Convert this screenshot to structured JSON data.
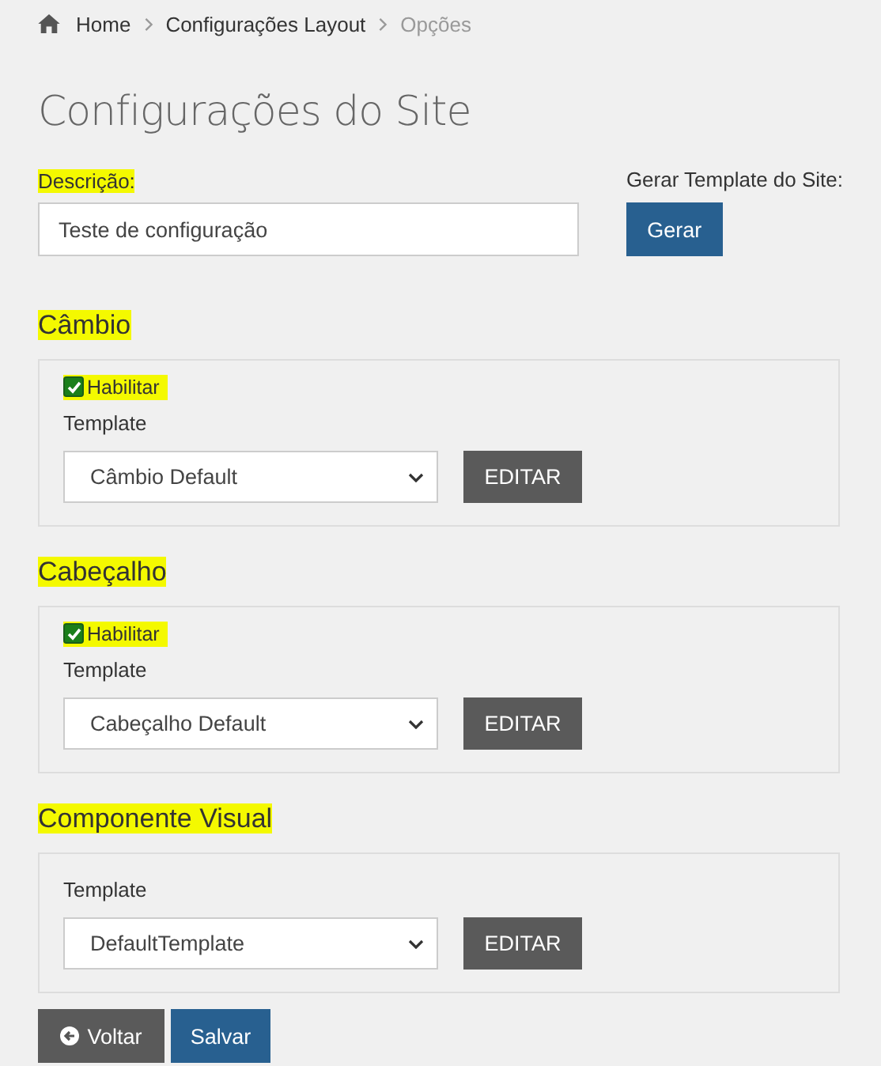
{
  "breadcrumb": [
    {
      "label": "Home",
      "current": false
    },
    {
      "label": "Configurações Layout",
      "current": false
    },
    {
      "label": "Opções",
      "current": true
    }
  ],
  "page_title": "Configurações do Site",
  "description": {
    "label": "Descrição:",
    "highlighted": true,
    "value": "Teste de configuração"
  },
  "generate": {
    "label": "Gerar Template do Site:",
    "button": "Gerar"
  },
  "sections": [
    {
      "heading": "Câmbio",
      "highlighted": true,
      "enable": {
        "label": "Habilitar",
        "checked": true,
        "highlighted": true
      },
      "template_label": "Template",
      "template_value": "Câmbio Default",
      "edit_button": "EDITAR"
    },
    {
      "heading": "Cabeçalho",
      "highlighted": true,
      "enable": {
        "label": "Habilitar",
        "checked": true,
        "highlighted": true
      },
      "template_label": "Template",
      "template_value": "Cabeçalho Default",
      "edit_button": "EDITAR"
    },
    {
      "heading": "Componente Visual",
      "highlighted": true,
      "template_label": "Template",
      "template_value": "DefaultTemplate",
      "edit_button": "EDITAR"
    }
  ],
  "footer_buttons": [
    {
      "label": "Voltar",
      "kind": "back"
    },
    {
      "label": "Salvar",
      "kind": "primary"
    }
  ]
}
